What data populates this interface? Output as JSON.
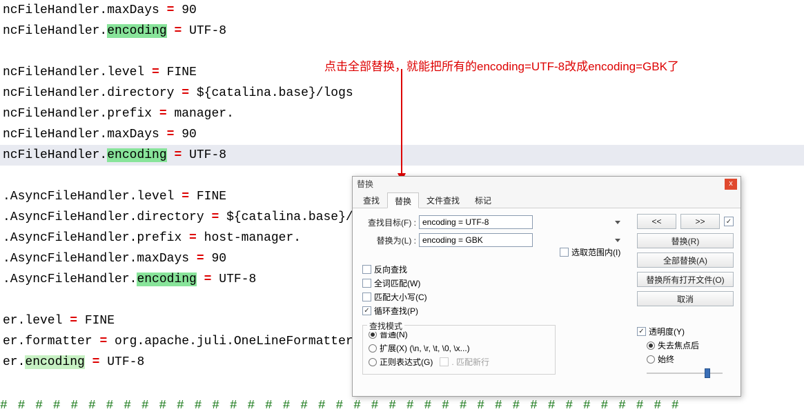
{
  "code": {
    "lines": [
      {
        "prefix": "ncFileHandler.",
        "prop": "maxDays",
        "val": "90",
        "hl": false
      },
      {
        "prefix": "ncFileHandler.",
        "prop": "encoding",
        "val": "UTF-8",
        "hl": true
      },
      {
        "blank": true
      },
      {
        "prefix": "ncFileHandler.",
        "prop": "level",
        "val": "FINE",
        "hl": false
      },
      {
        "prefix": "ncFileHandler.",
        "prop": "directory",
        "val": "${catalina.base}/logs",
        "hl": false
      },
      {
        "prefix": "ncFileHandler.",
        "prop": "prefix",
        "val": "manager.",
        "hl": false
      },
      {
        "prefix": "ncFileHandler.",
        "prop": "maxDays",
        "val": "90",
        "hl": false
      },
      {
        "prefix": "ncFileHandler.",
        "prop": "encoding",
        "val": "UTF-8",
        "hl": true,
        "selected": true
      },
      {
        "blank": true
      },
      {
        "prefix": ".AsyncFileHandler.",
        "prop": "level",
        "val": "FINE",
        "hl": false
      },
      {
        "prefix": ".AsyncFileHandler.",
        "prop": "directory",
        "val": "${catalina.base}/logs",
        "hl": false
      },
      {
        "prefix": ".AsyncFileHandler.",
        "prop": "prefix",
        "val": "host-manager.",
        "hl": false
      },
      {
        "prefix": ".AsyncFileHandler.",
        "prop": "maxDays",
        "val": "90",
        "hl": false
      },
      {
        "prefix": ".AsyncFileHandler.",
        "prop": "encoding",
        "val": "UTF-8",
        "hl": true
      },
      {
        "blank": true
      },
      {
        "prefix": "er.",
        "prop": "level",
        "val": "FINE",
        "hl": false
      },
      {
        "prefix": "er.",
        "prop": "formatter",
        "val": "org.apache.juli.OneLineFormatter",
        "hl": false
      },
      {
        "prefix": "er.",
        "prop": "encoding",
        "val": "UTF-8",
        "hl": true,
        "light": true
      }
    ],
    "ghost_wave": "# # # # # # # # # # # # # # # # # # # # # # # # # # # # # # # # # # # # # # #"
  },
  "annotation": {
    "text": "点击全部替换，就能把所有的encoding=UTF-8改成encoding=GBK了"
  },
  "dialog": {
    "title": "替换",
    "close": "x",
    "tabs": {
      "find": "查找",
      "replace": "替换",
      "findinfiles": "文件查找",
      "mark": "标记"
    },
    "fields": {
      "find_label": "查找目标(F) :",
      "find_value": "encoding = UTF-8",
      "replace_label": "替换为(L) :",
      "replace_value": "encoding = GBK"
    },
    "in_selection": "选取范围内(I)",
    "options": {
      "backward": "反向查找",
      "whole_word": "全词匹配(W)",
      "match_case": "匹配大小写(C)",
      "wrap": "循环查找(P)"
    },
    "search_mode": {
      "legend": "查找模式",
      "normal": "普通(N)",
      "extended": "扩展(X) (\\n, \\r, \\t, \\0, \\x...)",
      "regex": "正则表达式(G)",
      "dotnl": ". 匹配新行"
    },
    "transparency": {
      "title": "透明度(Y)",
      "on_lose": "失去焦点后",
      "always": "始终"
    },
    "buttons": {
      "prev": "<<",
      "next": ">>",
      "replace": "替换(R)",
      "replace_all": "全部替换(A)",
      "replace_open": "替换所有打开文件(O)",
      "cancel": "取消"
    }
  }
}
